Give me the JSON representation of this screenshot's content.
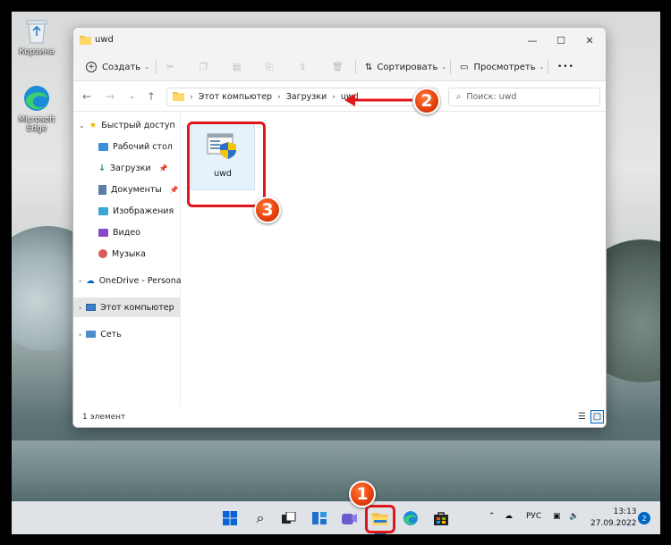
{
  "desktop": {
    "icons": [
      {
        "label": "Корзина",
        "icon": "recycle-bin-icon"
      },
      {
        "label": "Microsoft Edge",
        "icon": "edge-icon"
      }
    ]
  },
  "window": {
    "title": "uwd",
    "toolbar": {
      "create_label": "Создать",
      "sort_label": "Сортировать",
      "view_label": "Просмотреть",
      "more_label": "•••"
    },
    "address": {
      "segments": [
        "Этот компьютер",
        "Загрузки",
        "uwd"
      ]
    },
    "search": {
      "placeholder": "Поиск: uwd"
    },
    "sidebar": {
      "quick_access_label": "Быстрый доступ",
      "items": [
        {
          "label": "Рабочий стол",
          "icon": "desktop-folder-icon",
          "pinned": true
        },
        {
          "label": "Загрузки",
          "icon": "downloads-icon",
          "pinned": true
        },
        {
          "label": "Документы",
          "icon": "documents-icon",
          "pinned": true
        },
        {
          "label": "Изображения",
          "icon": "pictures-icon",
          "pinned": true
        },
        {
          "label": "Видео",
          "icon": "videos-icon",
          "pinned": false
        },
        {
          "label": "Музыка",
          "icon": "music-icon",
          "pinned": false
        }
      ],
      "onedrive_label": "OneDrive - Personal",
      "this_pc_label": "Этот компьютер",
      "network_label": "Сеть"
    },
    "files": [
      {
        "name": "uwd",
        "icon": "installer-app-icon"
      }
    ],
    "status": {
      "count_label": "1 элемент"
    }
  },
  "taskbar": {
    "language": "РУС",
    "time": "13:13",
    "date": "27.09.2022",
    "notifications": "2"
  },
  "annotations": {
    "step1": "1",
    "step2": "2",
    "step3": "3",
    "color": "#e0161b"
  }
}
